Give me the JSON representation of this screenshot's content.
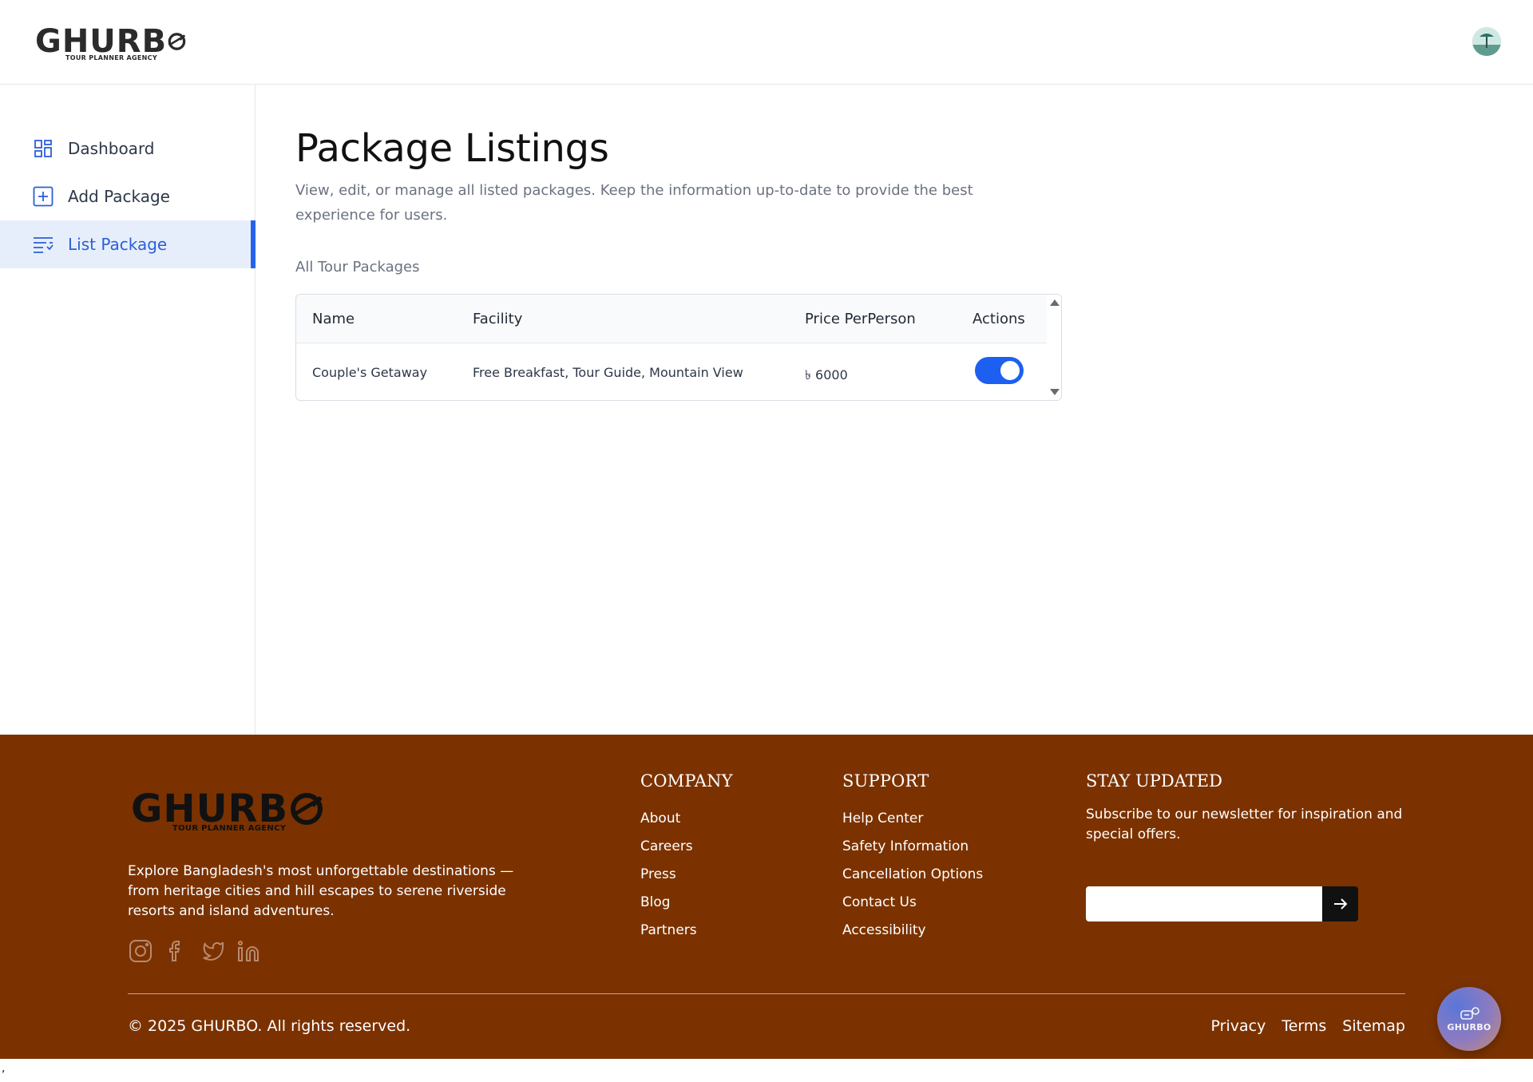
{
  "brand": {
    "name": "GHURB",
    "tagline": "TOUR PLANNER AGENCY"
  },
  "header": {
    "avatar_icon": "user-avatar"
  },
  "sidebar": {
    "items": [
      {
        "label": "Dashboard",
        "icon": "dashboard-icon",
        "active": false
      },
      {
        "label": "Add Package",
        "icon": "add-square-icon",
        "active": false
      },
      {
        "label": "List Package",
        "icon": "list-icon",
        "active": true
      }
    ]
  },
  "main": {
    "title": "Package Listings",
    "description": "View, edit, or manage all listed packages. Keep the information up-to-date to provide the best experience for users.",
    "section_label": "All Tour Packages",
    "table": {
      "columns": [
        "Name",
        "Facility",
        "Price PerPerson",
        "Actions"
      ],
      "rows": [
        {
          "name": "Couple's Getaway",
          "facility": "Free Breakfast, Tour Guide, Mountain View",
          "price": "৳ 6000",
          "active": true
        }
      ]
    }
  },
  "footer": {
    "brand_name": "GHURB",
    "brand_tagline": "TOUR PLANNER AGENCY",
    "description": "Explore Bangladesh's most unforgettable destinations — from heritage cities and hill escapes to serene riverside resorts and island adventures.",
    "socials": [
      "instagram-icon",
      "facebook-icon",
      "twitter-icon",
      "linkedin-icon"
    ],
    "company": {
      "heading": "COMPANY",
      "links": [
        "About",
        "Careers",
        "Press",
        "Blog",
        "Partners"
      ]
    },
    "support": {
      "heading": "SUPPORT",
      "links": [
        "Help Center",
        "Safety Information",
        "Cancellation Options",
        "Contact Us",
        "Accessibility"
      ]
    },
    "newsletter": {
      "heading": "STAY UPDATED",
      "text": "Subscribe to our newsletter for inspiration and special offers.",
      "placeholder": ""
    },
    "copyright": "© 2025 GHURBO. All rights reserved.",
    "legal": [
      "Privacy",
      "Terms",
      "Sitemap"
    ]
  },
  "chat_fab": {
    "label": "GHURBO"
  },
  "stray_char": ","
}
